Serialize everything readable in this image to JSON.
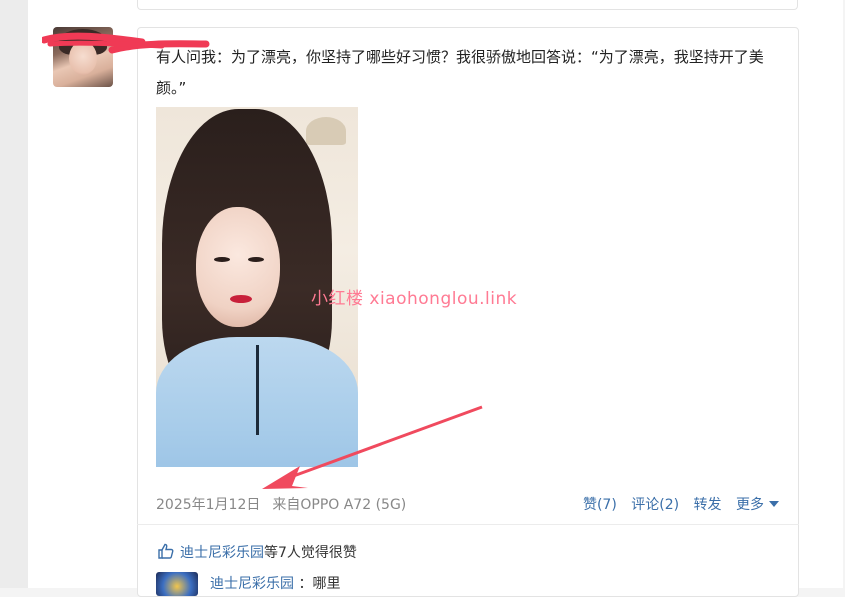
{
  "post": {
    "text": "有人问我：为了漂亮，你坚持了哪些好习惯？我很骄傲地回答说：“为了漂亮，我坚持开了美颜。”",
    "watermark": "小红楼 xiaohonglou.link",
    "date": "2025年1月12日",
    "source": "来自OPPO A72 (5G)"
  },
  "actions": {
    "like": "赞(7)",
    "comment": "评论(2)",
    "forward": "转发",
    "more": "更多"
  },
  "likes": {
    "user": "迪士尼彩乐园",
    "suffix_count": "等7人",
    "suffix_text": "觉得很赞"
  },
  "comment": {
    "user": "迪士尼彩乐园",
    "text": "：哪里"
  },
  "colors": {
    "link": "#3b6fa9",
    "annotation_arrow": "#f04a5e",
    "redaction": "#f03a55"
  },
  "icons": {
    "like": "thumbs-up-icon",
    "more": "caret-down-icon"
  }
}
